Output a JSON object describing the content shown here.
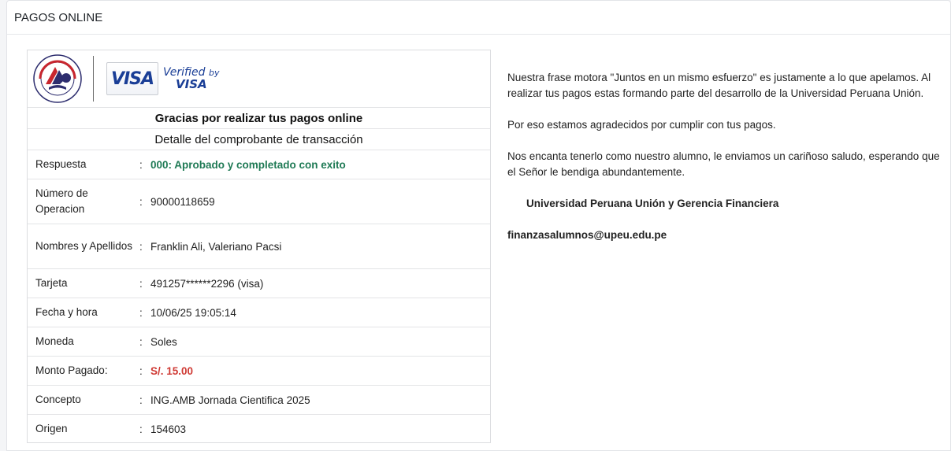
{
  "header": {
    "title": "PAGOS ONLINE"
  },
  "logos": {
    "university_seal_text": "UNIVERSIDAD PERUANA UNIÓN",
    "visa_label": "VISA",
    "verified_by_label": "Verified",
    "verified_by_small": "by",
    "verified_visa_label": "VISA",
    "brand_color": "#1a3e96"
  },
  "receipt": {
    "title": "Gracias por realizar tus pagos online",
    "subtitle": "Detalle del comprobante de transacción",
    "rows": [
      {
        "label": "Respuesta",
        "value": "000: Aprobado y completado con exito"
      },
      {
        "label": "Número de Operacion",
        "value": "90000118659"
      },
      {
        "label": "Nombres y Apellidos",
        "value": "Franklin Ali, Valeriano Pacsi"
      },
      {
        "label": "Tarjeta",
        "value": "491257******2296 (visa)"
      },
      {
        "label": "Fecha y hora",
        "value": "10/06/25 19:05:14"
      },
      {
        "label": "Moneda",
        "value": "Soles"
      },
      {
        "label": "Monto Pagado:",
        "value": "S/. 15.00"
      },
      {
        "label": "Concepto",
        "value": "ING.AMB Jornada Cientifica 2025"
      },
      {
        "label": "Origen",
        "value": "154603"
      }
    ],
    "separator": ":",
    "colors": {
      "approved": "#1f7a55",
      "amount": "#cf3a34"
    }
  },
  "message": {
    "paragraph1": "Nuestra frase motora \"Juntos en un mismo esfuerzo\" es justamente a lo que apelamos. Al realizar tus pagos estas formando parte del desarrollo de la Universidad Peruana Unión.",
    "paragraph2": "Por eso estamos agradecidos por cumplir con tus pagos.",
    "paragraph3": "Nos encanta tenerlo como nuestro alumno, le enviamos un cariñoso saludo, esperando que el Señor le bendiga abundantemente.",
    "signoff": "Universidad Peruana Unión y Gerencia Financiera",
    "email": "finanzasalumnos@upeu.edu.pe"
  }
}
